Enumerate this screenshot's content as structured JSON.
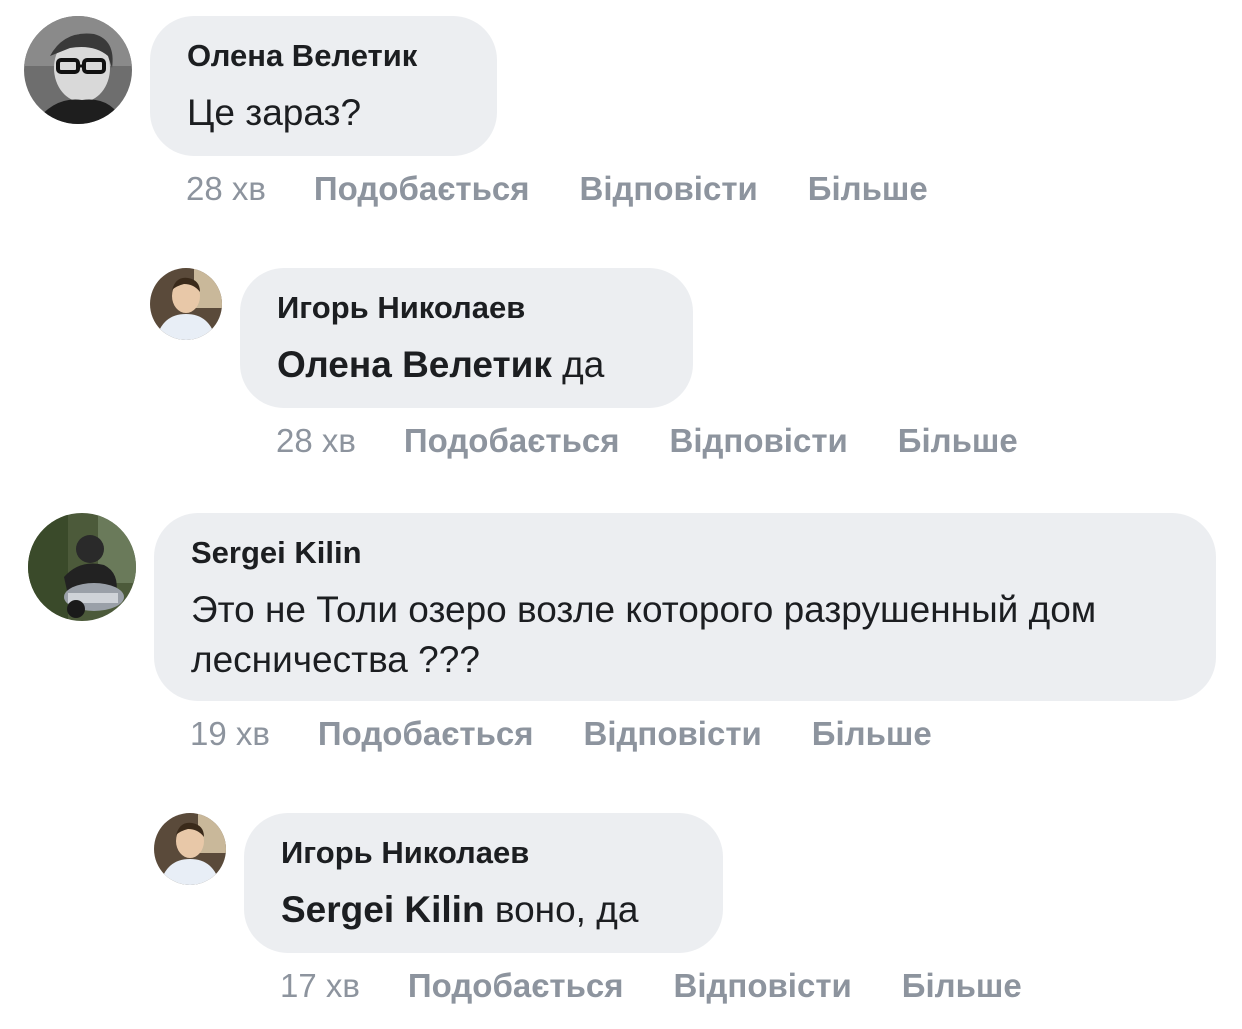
{
  "actions": {
    "like_label": "Подобається",
    "reply_label": "Відповісти",
    "more_label": "Більше"
  },
  "comments": [
    {
      "author": "Олена Велетик",
      "text": "Це зараз?",
      "time": "28 хв"
    },
    {
      "author": "Игорь Николаев",
      "mention": "Олена Велетик",
      "text": " да",
      "time": "28 хв"
    },
    {
      "author": "Sergei Kilin",
      "text": "Это не Толи озеро возле которого разрушенный дом лесничества ???",
      "time": "19 хв"
    },
    {
      "author": "Игорь Николаев",
      "mention": "Sergei Kilin",
      "text": " воно, да",
      "time": "17 хв"
    }
  ]
}
